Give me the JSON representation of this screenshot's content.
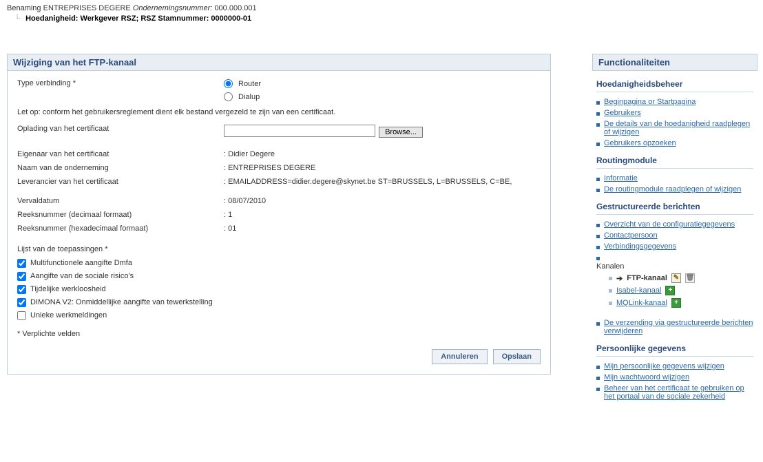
{
  "header": {
    "benaming_label": "Benaming",
    "company_name": "ENTREPRISES DEGERE",
    "ond_label": "Ondernemingsnummer:",
    "ond_value": "000.000.001",
    "hoedanigheid_label": "Hoedanigheid: Werkgever RSZ; RSZ Stamnummer:",
    "stamnummer": "0000000-01"
  },
  "panel": {
    "title": "Wijziging van het FTP-kanaal",
    "type_label": "Type verbinding  *",
    "radio_router": "Router",
    "radio_dialup": "Dialup",
    "note": "Let op: conform het gebruikersreglement dient elk bestand vergezeld te zijn van een certificaat.",
    "upload_label": "Oplading van het certificaat",
    "browse_label": "Browse...",
    "fields": {
      "owner_label": "Eigenaar van het certificaat",
      "owner_value": "Didier Degere",
      "company_label": "Naam van de onderneming",
      "company_value": "ENTREPRISES DEGERE",
      "supplier_label": "Leverancier van het certificaat",
      "supplier_value": "EMAILADDRESS=didier.degere@skynet.be  ST=BRUSSELS, L=BRUSSELS, C=BE,",
      "expiry_label": "Vervaldatum",
      "expiry_value": "08/07/2010",
      "serial_dec_label": "Reeksnummer (decimaal formaat)",
      "serial_dec_value": "1",
      "serial_hex_label": "Reeksnummer (hexadecimaal formaat)",
      "serial_hex_value": "01"
    },
    "apps_label": "Lijst van de toepassingen *",
    "apps": [
      "Multifunctionele aangifte Dmfa",
      "Aangifte van de sociale risico's",
      "Tijdelijke werkloosheid",
      "DIMONA V2: Onmiddellijke aangifte van tewerkstelling",
      "Unieke werkmeldingen"
    ],
    "footnote": "* Verplichte velden",
    "btn_cancel": "Annuleren",
    "btn_save": "Opslaan"
  },
  "side": {
    "title": "Functionaliteiten",
    "group_hoedanigheid": "Hoedanigheidsbeheer",
    "links_hoedanigheid": [
      "Beginpagina or Startpagina",
      "Gebruikers",
      "De details van de hoedanigheid raadplegen of wijzigen",
      "Gebruikers opzoeken"
    ],
    "group_routing": "Routingmodule",
    "links_routing": [
      "Informatie",
      "De routingmodule raadplegen of wijzigen"
    ],
    "group_structured": "Gestructureerde berichten",
    "links_structured_top": [
      "Overzicht van de configuratiegegevens",
      "Contactpersoon",
      "Verbindingsgegevens"
    ],
    "channels_label": "Kanalen",
    "channels": {
      "ftp": "FTP-kanaal",
      "isabel": "Isabel-kanaal",
      "mqlink": "MQLink-kanaal"
    },
    "link_delete_structured": "De verzending via gestructureerde berichten verwijderen",
    "group_personal": "Persoonlijke gegevens",
    "links_personal": [
      "Mijn persoonlijke gegevens wijzigen",
      "Mijn wachtwoord wijzigen",
      "Beheer van het certificaat te gebruiken op het portaal van de sociale zekerheid"
    ]
  }
}
